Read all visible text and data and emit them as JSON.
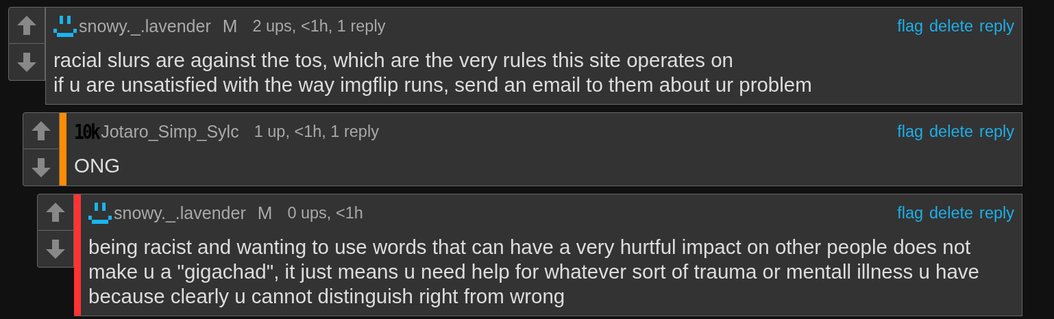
{
  "comments": [
    {
      "avatar": {
        "kind": "smiley"
      },
      "username": "snowy._.lavender",
      "badge": "M",
      "meta": "2 ups, <1h, 1 reply",
      "actions": [
        "flag",
        "delete",
        "reply"
      ],
      "text": "racial slurs are against the tos, which are the very rules this site operates on\nif u are unsatisfied with the way imgflip runs, send an email to them about ur problem",
      "children": [
        {
          "color": "#ff8c00",
          "avatar": {
            "kind": "rank",
            "label": "10k"
          },
          "username": "Jotaro_Simp_Sylc",
          "meta": "1 up, <1h, 1 reply",
          "actions": [
            "flag",
            "delete",
            "reply"
          ],
          "text": "ONG",
          "children": [
            {
              "color": "#ff3333",
              "avatar": {
                "kind": "smiley"
              },
              "username": "snowy._.lavender",
              "badge": "M",
              "meta": "0 ups, <1h",
              "actions": [
                "flag",
                "delete",
                "reply"
              ],
              "text": "being racist and wanting to use words that can have a very hurtful impact on other people does not\nmake u a \"gigachad\", it just means u need help for whatever sort of trauma or mentall illness u have\nbecause clearly u cannot distinguish right from wrong"
            }
          ]
        }
      ]
    }
  ]
}
